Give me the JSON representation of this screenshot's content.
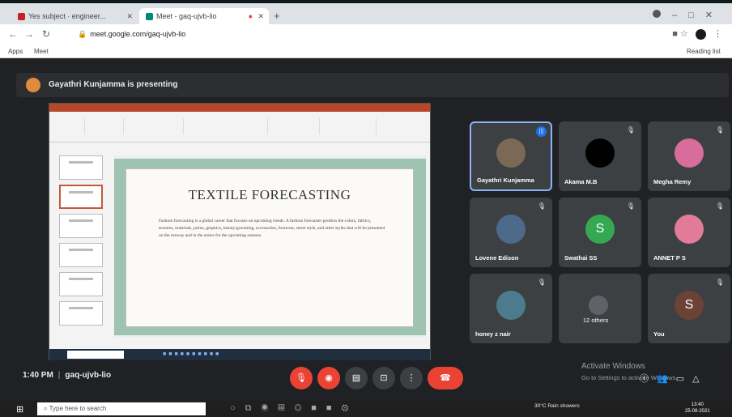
{
  "browser": {
    "tabs": [
      {
        "title": "Yes subject · engineer...",
        "active": false
      },
      {
        "title": "Meet - gaq-ujvb-lio",
        "active": true
      }
    ],
    "url": "meet.google.com/gaq-ujvb-lio",
    "bookmarks": [
      "Apps",
      "Meet",
      "Reading list"
    ]
  },
  "meet": {
    "presenting_text": "Gayathri Kunjamma is presenting",
    "time": "1:40 PM",
    "meeting_code": "gaq-ujvb-lio",
    "activate_title": "Activate Windows",
    "activate_sub": "Go to Settings to activate Windows."
  },
  "slide": {
    "title": "TEXTILE FORECASTING",
    "body": "Fashion forecasting is a global career that focuses on upcoming trends. A fashion forecaster predicts the colors, fabrics, textures, materials, prints, graphics, beauty/grooming, accessories, footwear, street style, and other styles that will be presented on the runway and in the stores for the upcoming seasons."
  },
  "participants": [
    {
      "name": "Gayathri Kunjamma",
      "initial": "",
      "avatar_color": "#7a6a55",
      "pinned": true
    },
    {
      "name": "Akama M.B",
      "initial": "",
      "avatar_color": "#000000",
      "pinned": false
    },
    {
      "name": "Megha Remy",
      "initial": "",
      "avatar_color": "#d86c9a",
      "pinned": false
    },
    {
      "name": "Lovene Edison",
      "initial": "",
      "avatar_color": "#4d6a8a",
      "pinned": false
    },
    {
      "name": "Swathai SS",
      "initial": "S",
      "avatar_color": "#34a853",
      "pinned": false
    },
    {
      "name": "ANNET P S",
      "initial": "",
      "avatar_color": "#e27a9a",
      "pinned": false
    },
    {
      "name": "honey z nair",
      "initial": "",
      "avatar_color": "#4b7b8c",
      "pinned": false
    },
    {
      "name": "12 others",
      "initial": "",
      "avatar_color": "#5f6368",
      "pinned": false
    },
    {
      "name": "You",
      "initial": "S",
      "avatar_color": "#6d4236",
      "pinned": false
    }
  ],
  "taskbar": {
    "search_placeholder": "Type here to search",
    "weather": "30°C Rain showers",
    "time": "13:40",
    "date": "25-08-2021"
  },
  "colors": {
    "accent": "#8ab4f8",
    "danger": "#ea4335",
    "tile": "#3c4043",
    "bg": "#202124"
  }
}
